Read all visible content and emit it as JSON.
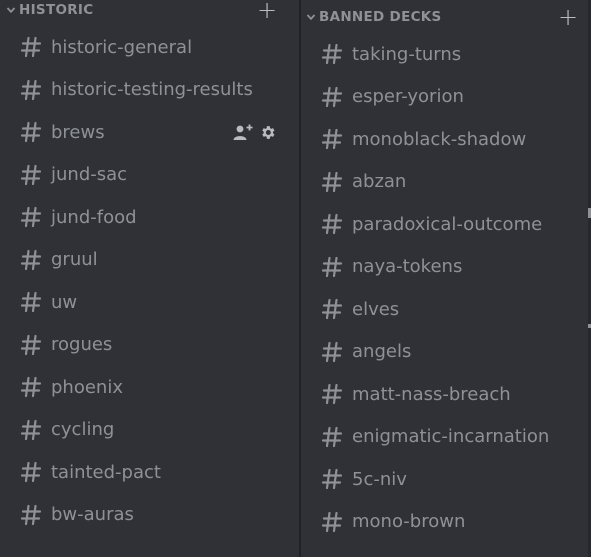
{
  "left_category": {
    "title": "HISTORIC",
    "add_icon": "plus-icon",
    "channels": [
      {
        "label": "historic-general"
      },
      {
        "label": "historic-testing-results"
      },
      {
        "label": "brews",
        "icons": [
          "add-member-icon",
          "gear-icon"
        ]
      },
      {
        "label": "jund-sac"
      },
      {
        "label": "jund-food"
      },
      {
        "label": "gruul"
      },
      {
        "label": "uw"
      },
      {
        "label": "rogues"
      },
      {
        "label": "phoenix"
      },
      {
        "label": "cycling"
      },
      {
        "label": "tainted-pact"
      },
      {
        "label": "bw-auras"
      }
    ]
  },
  "right_category": {
    "title": "BANNED DECKS",
    "add_icon": "plus-icon",
    "channels": [
      {
        "label": "taking-turns"
      },
      {
        "label": "esper-yorion"
      },
      {
        "label": "monoblack-shadow"
      },
      {
        "label": "abzan"
      },
      {
        "label": "paradoxical-outcome"
      },
      {
        "label": "naya-tokens"
      },
      {
        "label": "elves"
      },
      {
        "label": "angels"
      },
      {
        "label": "matt-nass-breach"
      },
      {
        "label": "enigmatic-incarnation"
      },
      {
        "label": "5c-niv"
      },
      {
        "label": "mono-brown"
      }
    ]
  },
  "colors": {
    "background": "#2f3136",
    "channel_text": "#8e9297",
    "divider": "#202225"
  }
}
